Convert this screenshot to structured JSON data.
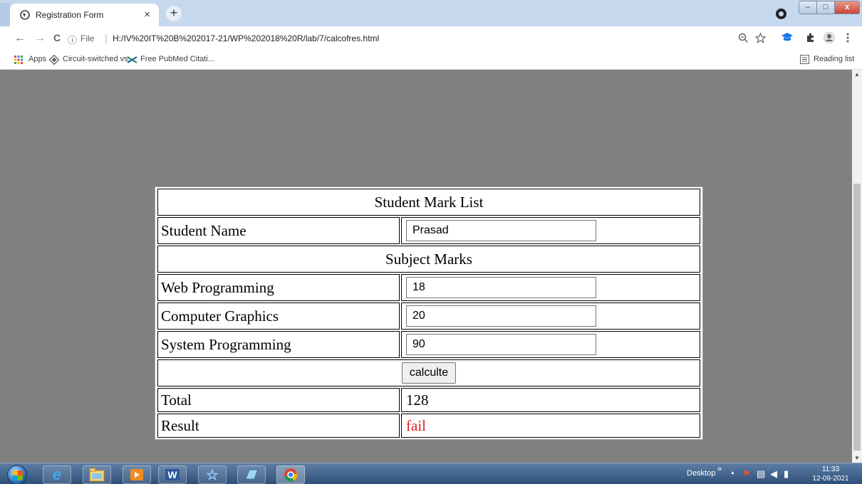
{
  "browser": {
    "tab_title": "Registration Form",
    "tab_close": "×",
    "new_tab": "+",
    "window_controls": {
      "minimize": "–",
      "maximize": "□",
      "close": "x"
    },
    "nav": {
      "back": "←",
      "forward": "→",
      "reload": "C"
    },
    "address": {
      "info_icon": "ⓘ",
      "scheme_label": "File",
      "separator": "|",
      "url": "H:/IV%20IT%20B%202017-21/WP%202018%20R/lab/7/calcofres.html"
    },
    "toolbar_icons": [
      "zoom-icon",
      "star-icon",
      "extension-cap-icon",
      "puzzle-icon",
      "profile-icon",
      "menu-icon"
    ]
  },
  "bookmarks": {
    "items": [
      {
        "label": "Apps",
        "icon": "apps-grid-icon"
      },
      {
        "label": "Circuit-switched vs...",
        "icon": "diamond-icon"
      },
      {
        "label": "Free PubMed Citati...",
        "icon": "x-green-icon"
      }
    ],
    "reading_list": "Reading list"
  },
  "form": {
    "title": "Student Mark List",
    "student_name_label": "Student Name",
    "student_name_value": "Prasad",
    "subject_marks_label": "Subject Marks",
    "subjects": [
      {
        "label": "Web Programming",
        "value": "18"
      },
      {
        "label": "Computer Graphics",
        "value": "20"
      },
      {
        "label": "System Programming",
        "value": "90"
      }
    ],
    "calculate_button": "calculte",
    "total_label": "Total",
    "total_value": "128",
    "result_label": "Result",
    "result_value": "fail",
    "result_color": "#e31e1e"
  },
  "taskbar": {
    "desktop_label": "Desktop",
    "chevron": "»",
    "tray_up": "▲",
    "time": "11:33",
    "date": "12-09-2021"
  }
}
